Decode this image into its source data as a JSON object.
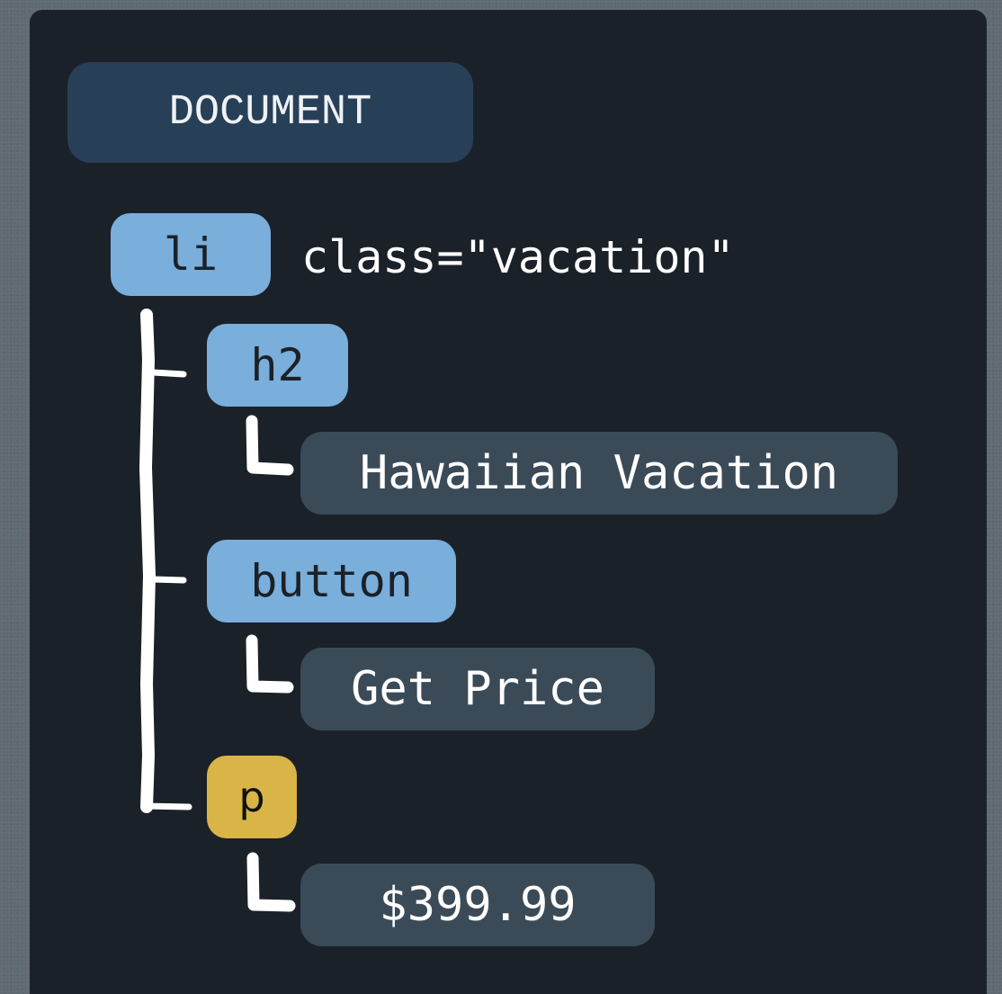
{
  "document_label": "DOCUMENT",
  "root": {
    "tag": "li",
    "attribute": "class=\"vacation\""
  },
  "children": [
    {
      "tag": "h2",
      "text": "Hawaiian Vacation"
    },
    {
      "tag": "button",
      "text": "Get Price"
    },
    {
      "tag": "p",
      "text": "$399.99"
    }
  ],
  "colors": {
    "panel": "#1b2128",
    "document_node": "#283f58",
    "element_node": "#7aaedb",
    "highlighted_element_node": "#d9b447",
    "text_node": "#3b4a57",
    "connector": "#ffffff"
  }
}
